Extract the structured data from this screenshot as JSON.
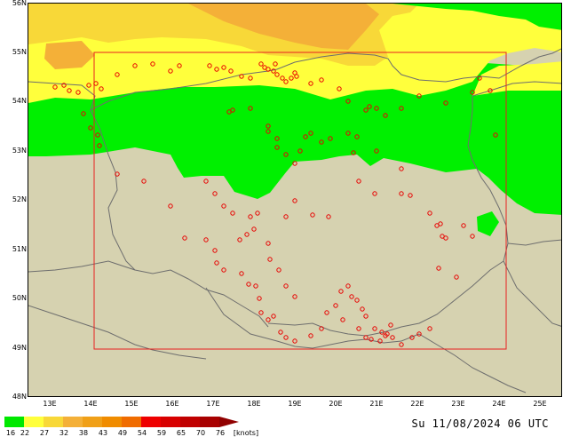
{
  "map": {
    "lat_labels": [
      "56N",
      "55N",
      "54N",
      "53N",
      "52N",
      "51N",
      "50N",
      "49N",
      "48N"
    ],
    "lon_labels": [
      "13E",
      "14E",
      "15E",
      "16E",
      "17E",
      "18E",
      "19E",
      "20E",
      "21E",
      "22E",
      "23E",
      "24E",
      "25E"
    ],
    "colors": {
      "land": "#d6d2b0",
      "wind_16_22": "#00f000",
      "wind_22_27": "#ffff3c",
      "wind_27_32": "#f8d838",
      "wind_32_38": "#f4b038",
      "sea": "#d6d2b0",
      "border": "#6e6e6e",
      "station": "#e80000",
      "domain_box": "#e82020"
    }
  },
  "legend": {
    "colors": [
      "#00e800",
      "#ffff3c",
      "#f8d838",
      "#f4b038",
      "#f0a018",
      "#f08c00",
      "#f06c00",
      "#ee0000",
      "#d80000",
      "#c00000",
      "#a80000",
      "#900000"
    ],
    "labels": [
      "16",
      "22",
      "27",
      "32",
      "38",
      "43",
      "49",
      "54",
      "59",
      "65",
      "70",
      "76"
    ],
    "unit": "[knots]"
  },
  "timestamp": "Su 11/08/2024 06 UTC"
}
